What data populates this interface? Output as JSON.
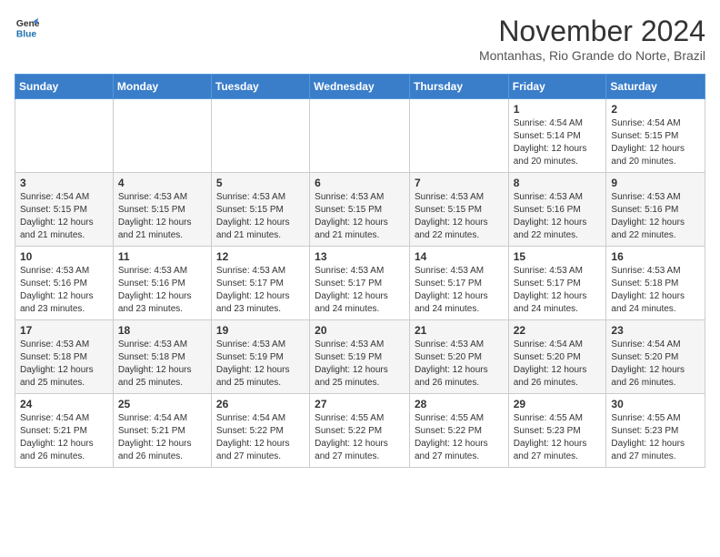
{
  "logo": {
    "line1": "General",
    "line2": "Blue"
  },
  "title": "November 2024",
  "location": "Montanhas, Rio Grande do Norte, Brazil",
  "days_header": [
    "Sunday",
    "Monday",
    "Tuesday",
    "Wednesday",
    "Thursday",
    "Friday",
    "Saturday"
  ],
  "weeks": [
    [
      {
        "day": "",
        "info": ""
      },
      {
        "day": "",
        "info": ""
      },
      {
        "day": "",
        "info": ""
      },
      {
        "day": "",
        "info": ""
      },
      {
        "day": "",
        "info": ""
      },
      {
        "day": "1",
        "info": "Sunrise: 4:54 AM\nSunset: 5:14 PM\nDaylight: 12 hours and 20 minutes."
      },
      {
        "day": "2",
        "info": "Sunrise: 4:54 AM\nSunset: 5:15 PM\nDaylight: 12 hours and 20 minutes."
      }
    ],
    [
      {
        "day": "3",
        "info": "Sunrise: 4:54 AM\nSunset: 5:15 PM\nDaylight: 12 hours and 21 minutes."
      },
      {
        "day": "4",
        "info": "Sunrise: 4:53 AM\nSunset: 5:15 PM\nDaylight: 12 hours and 21 minutes."
      },
      {
        "day": "5",
        "info": "Sunrise: 4:53 AM\nSunset: 5:15 PM\nDaylight: 12 hours and 21 minutes."
      },
      {
        "day": "6",
        "info": "Sunrise: 4:53 AM\nSunset: 5:15 PM\nDaylight: 12 hours and 21 minutes."
      },
      {
        "day": "7",
        "info": "Sunrise: 4:53 AM\nSunset: 5:15 PM\nDaylight: 12 hours and 22 minutes."
      },
      {
        "day": "8",
        "info": "Sunrise: 4:53 AM\nSunset: 5:16 PM\nDaylight: 12 hours and 22 minutes."
      },
      {
        "day": "9",
        "info": "Sunrise: 4:53 AM\nSunset: 5:16 PM\nDaylight: 12 hours and 22 minutes."
      }
    ],
    [
      {
        "day": "10",
        "info": "Sunrise: 4:53 AM\nSunset: 5:16 PM\nDaylight: 12 hours and 23 minutes."
      },
      {
        "day": "11",
        "info": "Sunrise: 4:53 AM\nSunset: 5:16 PM\nDaylight: 12 hours and 23 minutes."
      },
      {
        "day": "12",
        "info": "Sunrise: 4:53 AM\nSunset: 5:17 PM\nDaylight: 12 hours and 23 minutes."
      },
      {
        "day": "13",
        "info": "Sunrise: 4:53 AM\nSunset: 5:17 PM\nDaylight: 12 hours and 24 minutes."
      },
      {
        "day": "14",
        "info": "Sunrise: 4:53 AM\nSunset: 5:17 PM\nDaylight: 12 hours and 24 minutes."
      },
      {
        "day": "15",
        "info": "Sunrise: 4:53 AM\nSunset: 5:17 PM\nDaylight: 12 hours and 24 minutes."
      },
      {
        "day": "16",
        "info": "Sunrise: 4:53 AM\nSunset: 5:18 PM\nDaylight: 12 hours and 24 minutes."
      }
    ],
    [
      {
        "day": "17",
        "info": "Sunrise: 4:53 AM\nSunset: 5:18 PM\nDaylight: 12 hours and 25 minutes."
      },
      {
        "day": "18",
        "info": "Sunrise: 4:53 AM\nSunset: 5:18 PM\nDaylight: 12 hours and 25 minutes."
      },
      {
        "day": "19",
        "info": "Sunrise: 4:53 AM\nSunset: 5:19 PM\nDaylight: 12 hours and 25 minutes."
      },
      {
        "day": "20",
        "info": "Sunrise: 4:53 AM\nSunset: 5:19 PM\nDaylight: 12 hours and 25 minutes."
      },
      {
        "day": "21",
        "info": "Sunrise: 4:53 AM\nSunset: 5:20 PM\nDaylight: 12 hours and 26 minutes."
      },
      {
        "day": "22",
        "info": "Sunrise: 4:54 AM\nSunset: 5:20 PM\nDaylight: 12 hours and 26 minutes."
      },
      {
        "day": "23",
        "info": "Sunrise: 4:54 AM\nSunset: 5:20 PM\nDaylight: 12 hours and 26 minutes."
      }
    ],
    [
      {
        "day": "24",
        "info": "Sunrise: 4:54 AM\nSunset: 5:21 PM\nDaylight: 12 hours and 26 minutes."
      },
      {
        "day": "25",
        "info": "Sunrise: 4:54 AM\nSunset: 5:21 PM\nDaylight: 12 hours and 26 minutes."
      },
      {
        "day": "26",
        "info": "Sunrise: 4:54 AM\nSunset: 5:22 PM\nDaylight: 12 hours and 27 minutes."
      },
      {
        "day": "27",
        "info": "Sunrise: 4:55 AM\nSunset: 5:22 PM\nDaylight: 12 hours and 27 minutes."
      },
      {
        "day": "28",
        "info": "Sunrise: 4:55 AM\nSunset: 5:22 PM\nDaylight: 12 hours and 27 minutes."
      },
      {
        "day": "29",
        "info": "Sunrise: 4:55 AM\nSunset: 5:23 PM\nDaylight: 12 hours and 27 minutes."
      },
      {
        "day": "30",
        "info": "Sunrise: 4:55 AM\nSunset: 5:23 PM\nDaylight: 12 hours and 27 minutes."
      }
    ]
  ]
}
